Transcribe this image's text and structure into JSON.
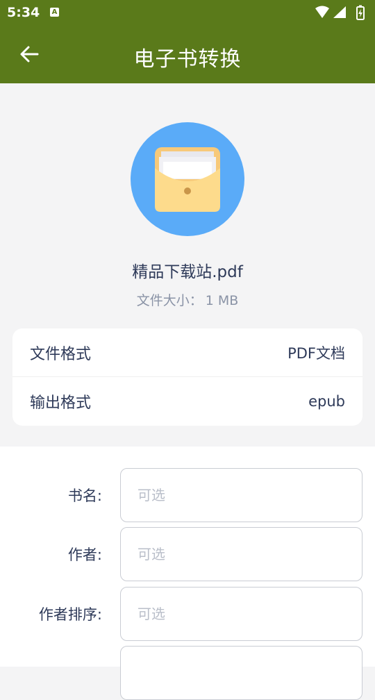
{
  "status_bar": {
    "time": "5:34",
    "notification_icon": "A",
    "icons": [
      "wifi-icon",
      "signal-icon",
      "battery-charging-icon"
    ]
  },
  "app_bar": {
    "back_icon": "arrow-left-icon",
    "title": "电子书转换"
  },
  "file": {
    "icon": "folder-document-icon",
    "name": "精品下载站.pdf",
    "size_label": "文件大小：",
    "size_value": "1 MB"
  },
  "info": {
    "rows": [
      {
        "label": "文件格式",
        "value": "PDF文档"
      },
      {
        "label": "输出格式",
        "value": "epub"
      }
    ]
  },
  "form": {
    "fields": [
      {
        "label": "书名:",
        "placeholder": "可选"
      },
      {
        "label": "作者:",
        "placeholder": "可选"
      },
      {
        "label": "作者排序:",
        "placeholder": "可选"
      },
      {
        "label": "",
        "placeholder": ""
      }
    ]
  },
  "colors": {
    "primary": "#5a7a1a",
    "icon_circle": "#5aabf8",
    "text": "#2e3a59",
    "secondary_text": "#8a93a6"
  }
}
